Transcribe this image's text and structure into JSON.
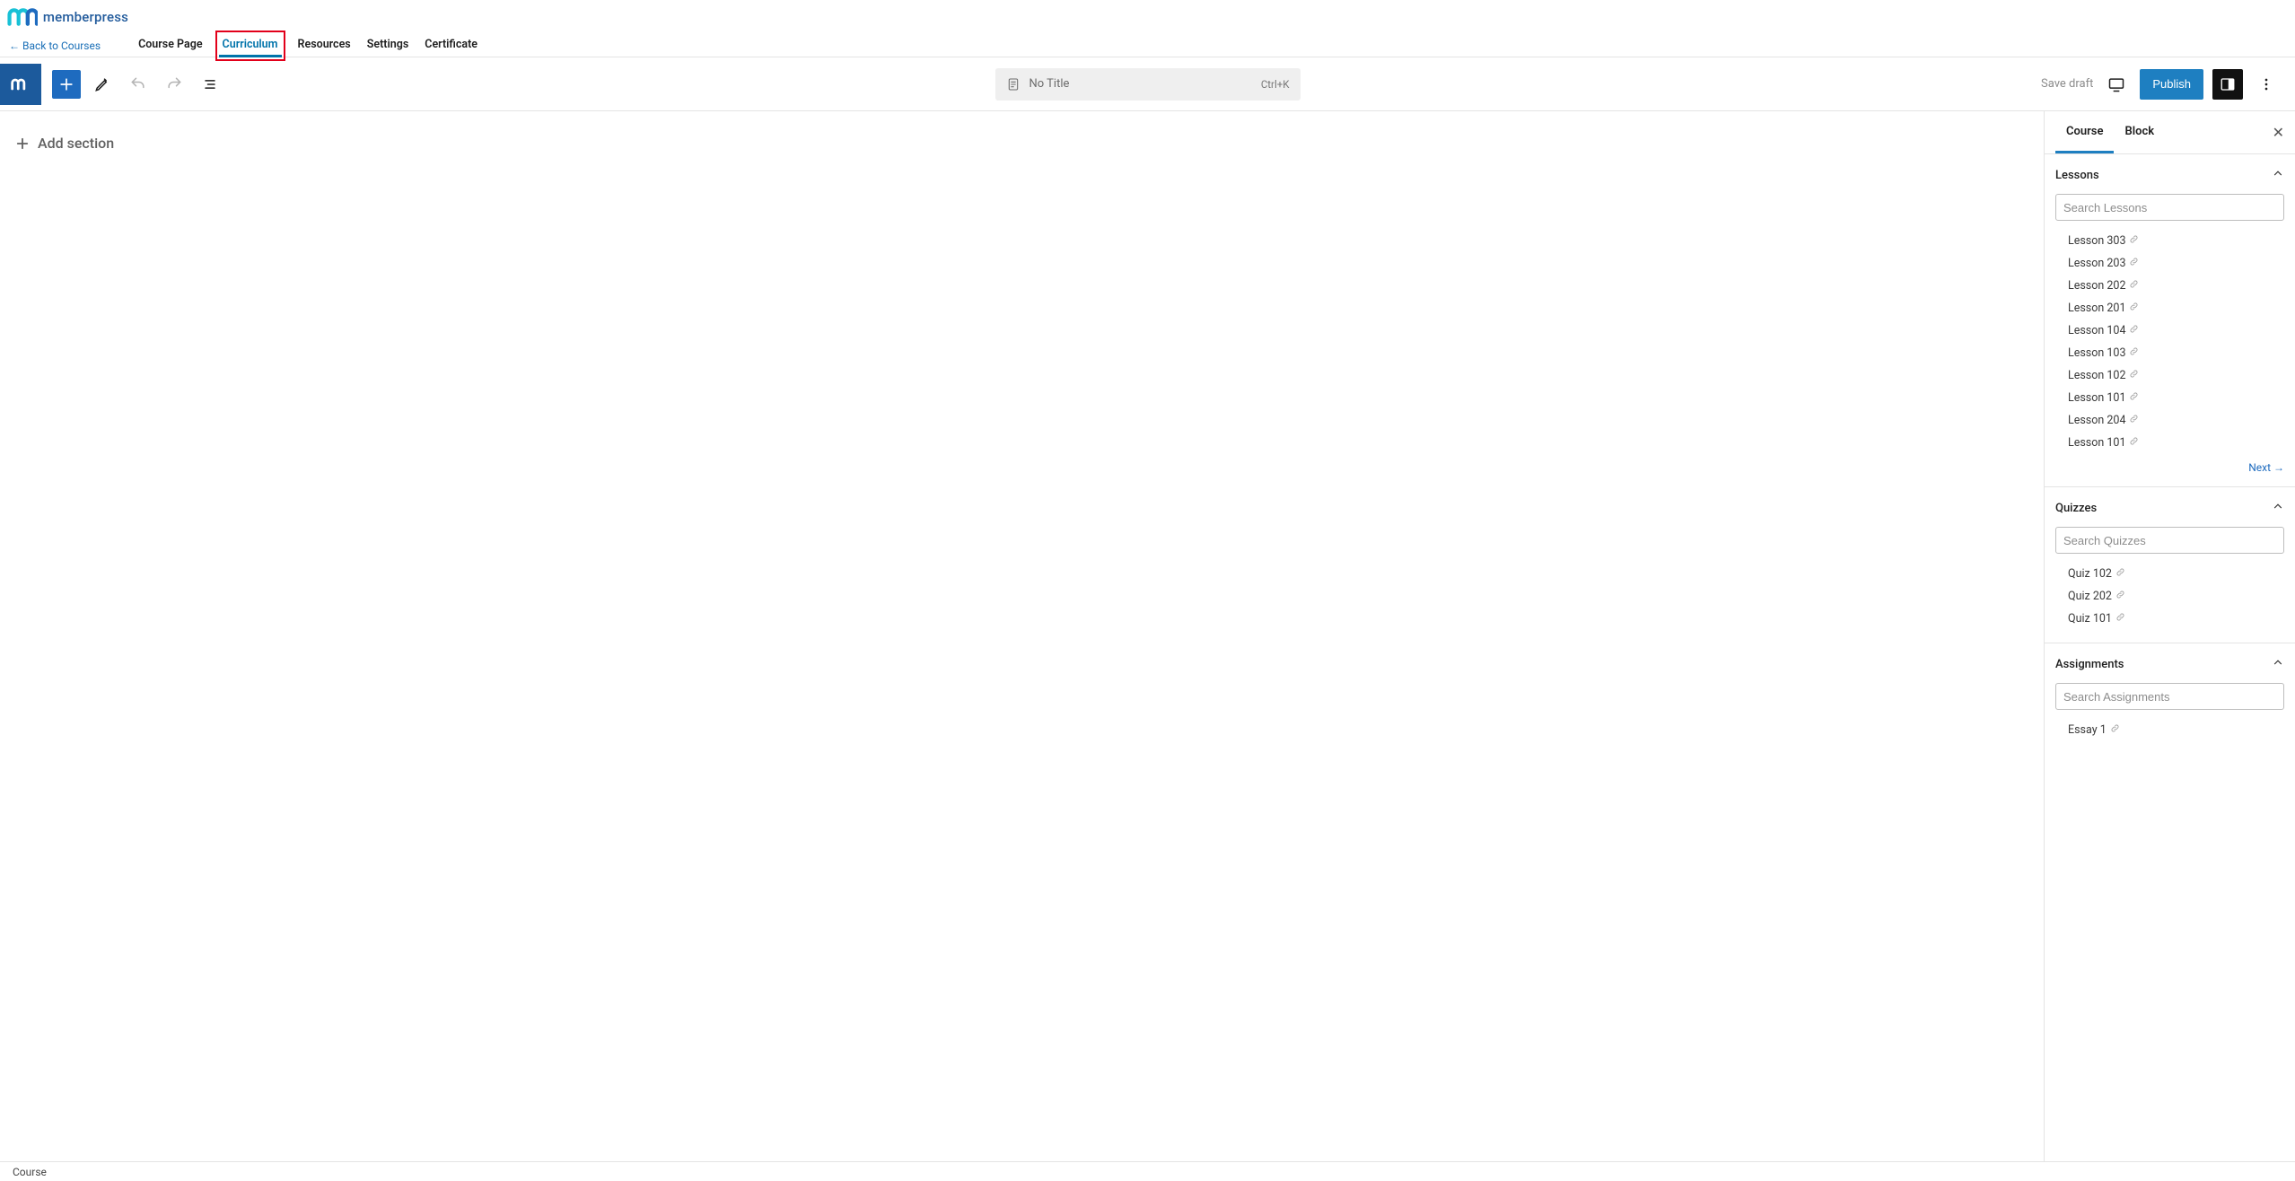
{
  "brand": {
    "name": "memberpress"
  },
  "back_link": "Back to Courses",
  "nav": {
    "course_page": "Course Page",
    "curriculum": "Curriculum",
    "resources": "Resources",
    "settings": "Settings",
    "certificate": "Certificate"
  },
  "toolbar": {
    "title_label": "No Title",
    "shortcut": "Ctrl+K",
    "save_draft": "Save draft",
    "publish": "Publish"
  },
  "canvas": {
    "add_section": "Add section"
  },
  "sidebar": {
    "tabs": {
      "course": "Course",
      "block": "Block"
    },
    "lessons": {
      "title": "Lessons",
      "search_placeholder": "Search Lessons",
      "items": [
        "Lesson 303",
        "Lesson 203",
        "Lesson 202",
        "Lesson 201",
        "Lesson 104",
        "Lesson 103",
        "Lesson 102",
        "Lesson 101",
        "Lesson 204",
        "Lesson 101"
      ],
      "next": "Next"
    },
    "quizzes": {
      "title": "Quizzes",
      "search_placeholder": "Search Quizzes",
      "items": [
        "Quiz 102",
        "Quiz 202",
        "Quiz 101"
      ]
    },
    "assignments": {
      "title": "Assignments",
      "search_placeholder": "Search Assignments",
      "items": [
        "Essay 1"
      ]
    }
  },
  "status": {
    "breadcrumb": "Course"
  }
}
